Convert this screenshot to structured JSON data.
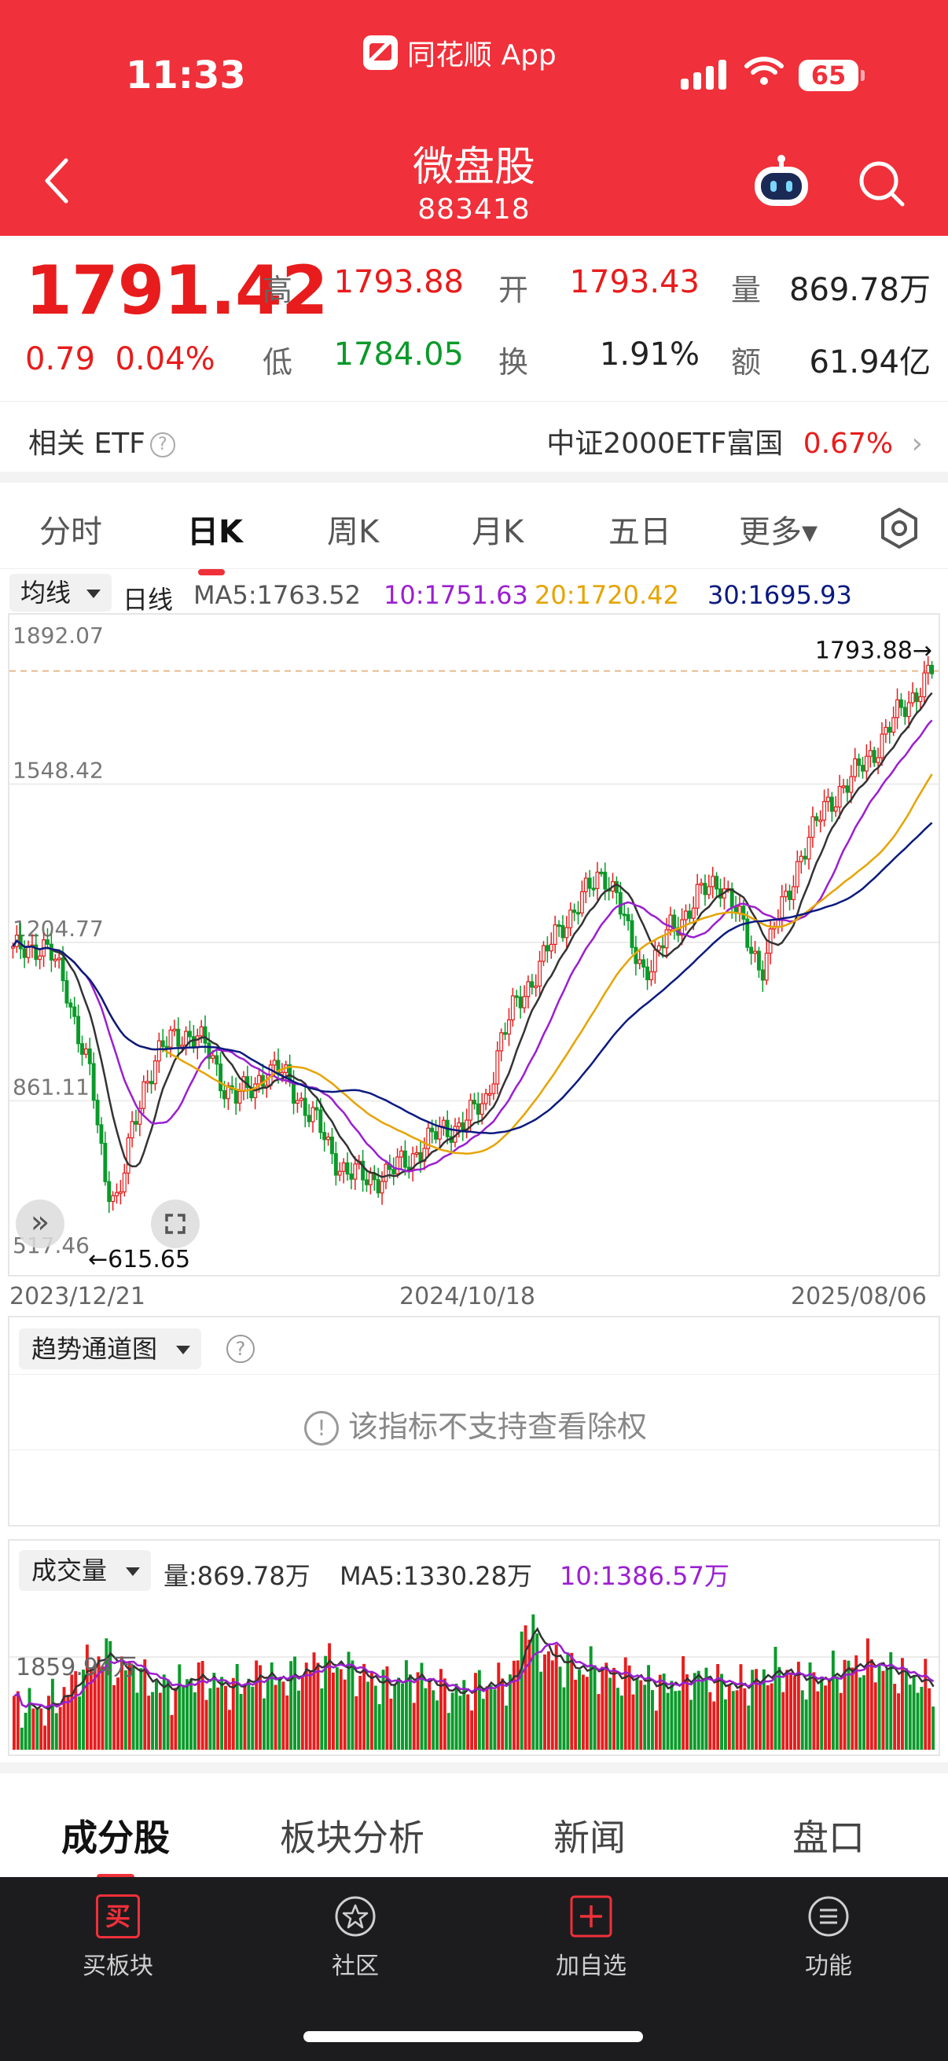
{
  "status": {
    "time": "11:33",
    "app_name": "同花顺 App",
    "battery": "65"
  },
  "header": {
    "title": "微盘股",
    "code": "883418"
  },
  "quote": {
    "price": "1791.42",
    "change": "0.79",
    "change_pct": "0.04%",
    "high_label": "高",
    "high": "1793.88",
    "open_label": "开",
    "open": "1793.43",
    "volume_label": "量",
    "volume": "869.78万",
    "low_label": "低",
    "low": "1784.05",
    "turnover_label": "换",
    "turnover": "1.91%",
    "amount_label": "额",
    "amount": "61.94亿"
  },
  "etf": {
    "label": "相关 ETF",
    "help": "?",
    "name": "中证2000ETF富国",
    "pct": "0.67%"
  },
  "tabs": [
    "分时",
    "日K",
    "周K",
    "月K",
    "五日",
    "更多▾"
  ],
  "ma": {
    "selector": "均线",
    "period": "日线",
    "ma5": "MA5:1763.52",
    "ma10": "10:1751.63",
    "ma20": "20:1720.42",
    "ma30": "30:1695.93"
  },
  "colors": {
    "up": "#e81c1c",
    "down": "#0a9a2a",
    "ma5": "#333333",
    "ma10": "#9b1fd1",
    "ma20": "#e6a400",
    "ma30": "#0b1a80",
    "brand": "#f0303a"
  },
  "chart_data": {
    "type": "candlestick",
    "y_labels": [
      "1892.07",
      "1548.42",
      "1204.77",
      "861.11",
      "517.46"
    ],
    "ylim": [
      517.46,
      1892.07
    ],
    "high_mark": "1793.88→",
    "low_mark": "←615.65",
    "x_labels": [
      "2023/12/21",
      "2024/10/18",
      "2025/08/06"
    ],
    "close_trend": [
      1180,
      1200,
      1195,
      1170,
      1120,
      1000,
      900,
      700,
      640,
      780,
      900,
      960,
      990,
      1010,
      1000,
      960,
      900,
      870,
      880,
      920,
      930,
      900,
      860,
      820,
      760,
      720,
      700,
      690,
      700,
      710,
      730,
      760,
      780,
      800,
      810,
      830,
      860,
      980,
      1050,
      1100,
      1150,
      1200,
      1250,
      1290,
      1320,
      1360,
      1310,
      1200,
      1150,
      1170,
      1230,
      1260,
      1300,
      1320,
      1340,
      1280,
      1200,
      1150,
      1240,
      1300,
      1400,
      1450,
      1500,
      1540,
      1560,
      1600,
      1640,
      1680,
      1720,
      1760,
      1791
    ]
  },
  "indicator": {
    "selector": "趋势通道图",
    "help": "?",
    "notice": "该指标不支持查看除权"
  },
  "volume": {
    "selector": "成交量",
    "vol": "量:869.78万",
    "ma5": "MA5:1330.28万",
    "ma10": "10:1386.57万",
    "y_label": "1859.94万",
    "bars": [
      30,
      32,
      28,
      35,
      40,
      55,
      62,
      70,
      55,
      60,
      48,
      45,
      42,
      50,
      52,
      48,
      44,
      46,
      50,
      54,
      48,
      52,
      56,
      60,
      62,
      58,
      55,
      50,
      46,
      48,
      52,
      50,
      45,
      42,
      40,
      44,
      46,
      48,
      50,
      95,
      70,
      65,
      60,
      56,
      58,
      55,
      50,
      52,
      48,
      44,
      46,
      50,
      52,
      48,
      46,
      44,
      48,
      52,
      56,
      54,
      50,
      48,
      52,
      56,
      60,
      62,
      58,
      55,
      52,
      48,
      45
    ]
  },
  "subtabs": [
    "成分股",
    "板块分析",
    "新闻",
    "盘口"
  ],
  "bottom_nav": [
    "买板块",
    "社区",
    "加自选",
    "功能"
  ],
  "bottom_icons": {
    "buy": "买"
  }
}
